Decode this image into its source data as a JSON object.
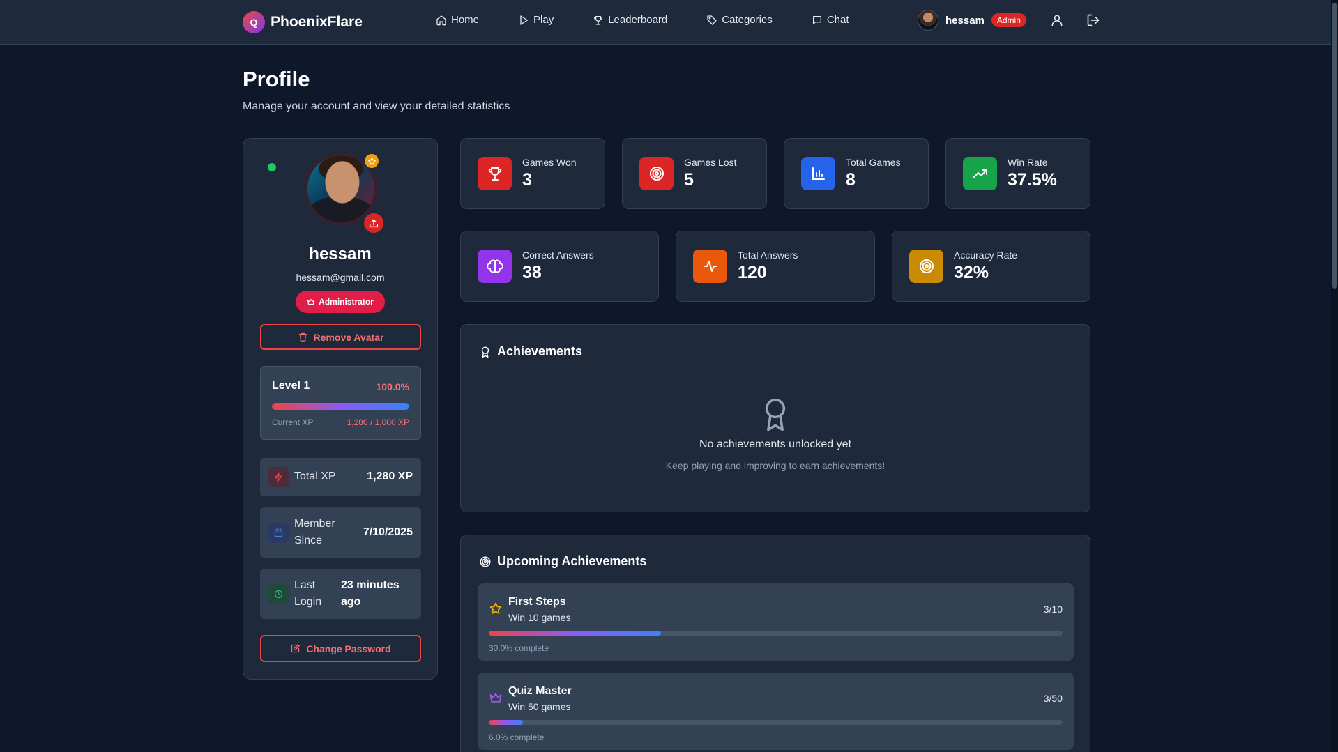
{
  "nav": {
    "brand_letter": "Q",
    "brand_name": "PhoenixFlare",
    "items": [
      {
        "label": "Home",
        "icon": "home-icon"
      },
      {
        "label": "Play",
        "icon": "play-icon"
      },
      {
        "label": "Leaderboard",
        "icon": "trophy-icon"
      },
      {
        "label": "Categories",
        "icon": "tag-icon"
      },
      {
        "label": "Chat",
        "icon": "chat-icon"
      }
    ],
    "user_name": "hessam",
    "user_badge": "Admin"
  },
  "page": {
    "title": "Profile",
    "subtitle": "Manage your account and view your detailed statistics"
  },
  "profile": {
    "name": "hessam",
    "email": "hessam@gmail.com",
    "role": "Administrator",
    "remove_avatar_label": "Remove Avatar",
    "level_label": "Level 1",
    "level_percent": "100.0%",
    "level_progress": 1.0,
    "current_xp_label": "Current XP",
    "current_xp_value": "1,280 / 1,000 XP",
    "total_xp_label": "Total XP",
    "total_xp_value": "1,280 XP",
    "member_since_label": "Member Since",
    "member_since_value": "7/10/2025",
    "last_login_label": "Last Login",
    "last_login_value": "23 minutes ago",
    "change_password_label": "Change Password"
  },
  "stats_top": [
    {
      "label": "Games Won",
      "value": "3",
      "icon": "trophy-icon",
      "color": "#dc2626"
    },
    {
      "label": "Games Lost",
      "value": "5",
      "icon": "target-icon",
      "color": "#dc2626"
    },
    {
      "label": "Total Games",
      "value": "8",
      "icon": "bar-chart-icon",
      "color": "#2563eb"
    },
    {
      "label": "Win Rate",
      "value": "37.5%",
      "icon": "trending-up-icon",
      "color": "#16a34a"
    }
  ],
  "stats_bottom": [
    {
      "label": "Correct Answers",
      "value": "38",
      "icon": "brain-icon",
      "color": "#9333ea"
    },
    {
      "label": "Total Answers",
      "value": "120",
      "icon": "activity-icon",
      "color": "#ea580c"
    },
    {
      "label": "Accuracy Rate",
      "value": "32%",
      "icon": "target-icon",
      "color": "#ca8a04"
    }
  ],
  "achievements": {
    "title": "Achievements",
    "empty_title": "No achievements unlocked yet",
    "empty_subtitle": "Keep playing and improving to earn achievements!"
  },
  "upcoming": {
    "title": "Upcoming Achievements",
    "items": [
      {
        "name": "First Steps",
        "desc": "Win 10 games",
        "count": "3/10",
        "progress": 0.3,
        "pct_label": "30.0% complete",
        "icon": "star-icon"
      },
      {
        "name": "Quiz Master",
        "desc": "Win 50 games",
        "count": "3/50",
        "progress": 0.06,
        "pct_label": "6.0% complete",
        "icon": "crown-icon"
      }
    ]
  }
}
